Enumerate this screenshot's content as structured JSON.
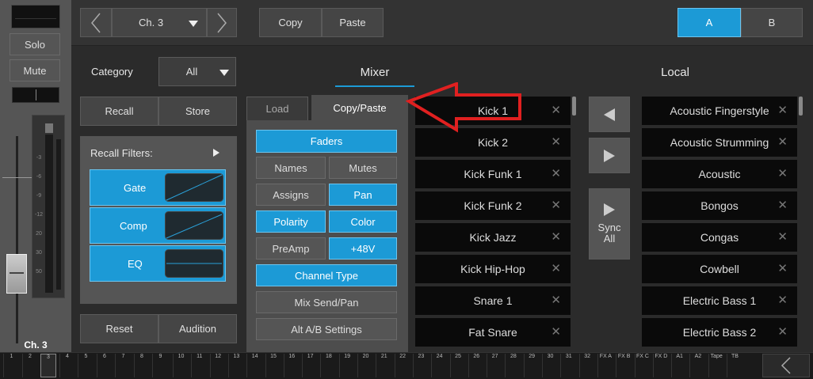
{
  "strip": {
    "solo": "Solo",
    "mute": "Mute",
    "channel_label": "Ch. 3",
    "scale": [
      "-3",
      "-6",
      "-9",
      "-12",
      "20",
      "30",
      "50"
    ]
  },
  "topbar": {
    "channel": "Ch. 3",
    "copy": "Copy",
    "paste": "Paste",
    "a": "A",
    "b": "B"
  },
  "left": {
    "category_label": "Category",
    "category_value": "All",
    "recall": "Recall",
    "store": "Store",
    "recall_filters": "Recall Filters:",
    "gate": "Gate",
    "comp": "Comp",
    "eq": "EQ",
    "reset": "Reset",
    "audition": "Audition"
  },
  "tabs": {
    "load": "Load",
    "copypaste": "Copy/Paste"
  },
  "copypaste": {
    "faders": "Faders",
    "names": "Names",
    "mutes": "Mutes",
    "assigns": "Assigns",
    "pan": "Pan",
    "polarity": "Polarity",
    "color": "Color",
    "preamp": "PreAmp",
    "phantom": "+48V",
    "channel_type": "Channel Type",
    "mix_send_pan": "Mix Send/Pan",
    "alt_ab": "Alt A/B Settings"
  },
  "mixer": {
    "title": "Mixer",
    "items": [
      "Kick 1",
      "Kick 2",
      "Kick Funk 1",
      "Kick Funk 2",
      "Kick Jazz",
      "Kick Hip-Hop",
      "Snare 1",
      "Fat Snare"
    ]
  },
  "local": {
    "title": "Local",
    "items": [
      "Acoustic Fingerstyle",
      "Acoustic Strumming",
      "Acoustic",
      "Bongos",
      "Congas",
      "Cowbell",
      "Electric Bass 1",
      "Electric Bass 2"
    ]
  },
  "middle": {
    "sync_all": "Sync All"
  },
  "bottom": {
    "channels": [
      "1",
      "2",
      "3",
      "4",
      "5",
      "6",
      "7",
      "8",
      "9",
      "10",
      "11",
      "12",
      "13",
      "14",
      "15",
      "16",
      "17",
      "18",
      "19",
      "20",
      "21",
      "22",
      "23",
      "24",
      "25",
      "26",
      "27",
      "28",
      "29",
      "30",
      "31",
      "32",
      "FX A",
      "FX B",
      "FX C",
      "FX D",
      "A1",
      "A2",
      "Tape",
      "TB"
    ]
  },
  "colors": {
    "accent": "#1c9ad6",
    "arrow": "#e02020"
  }
}
